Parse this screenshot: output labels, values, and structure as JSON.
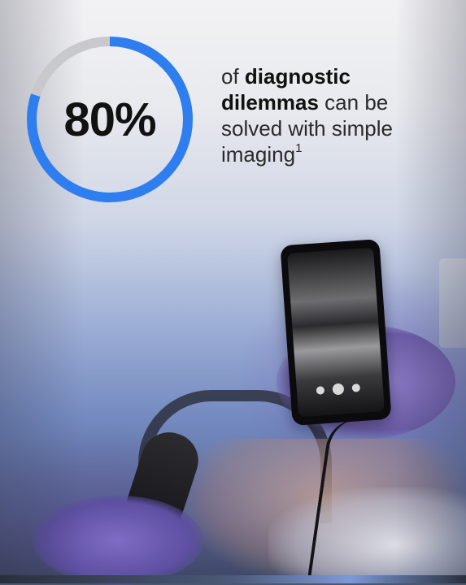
{
  "stat": {
    "value": "80%",
    "progress_fraction": 0.8,
    "ring_color": "#2f7ef0",
    "ring_track_color": "#c9c9cd",
    "text_part1": "of ",
    "text_bold": "diagnostic dilemmas",
    "text_part2": " can be solved with simple imaging",
    "footnote": "1"
  }
}
